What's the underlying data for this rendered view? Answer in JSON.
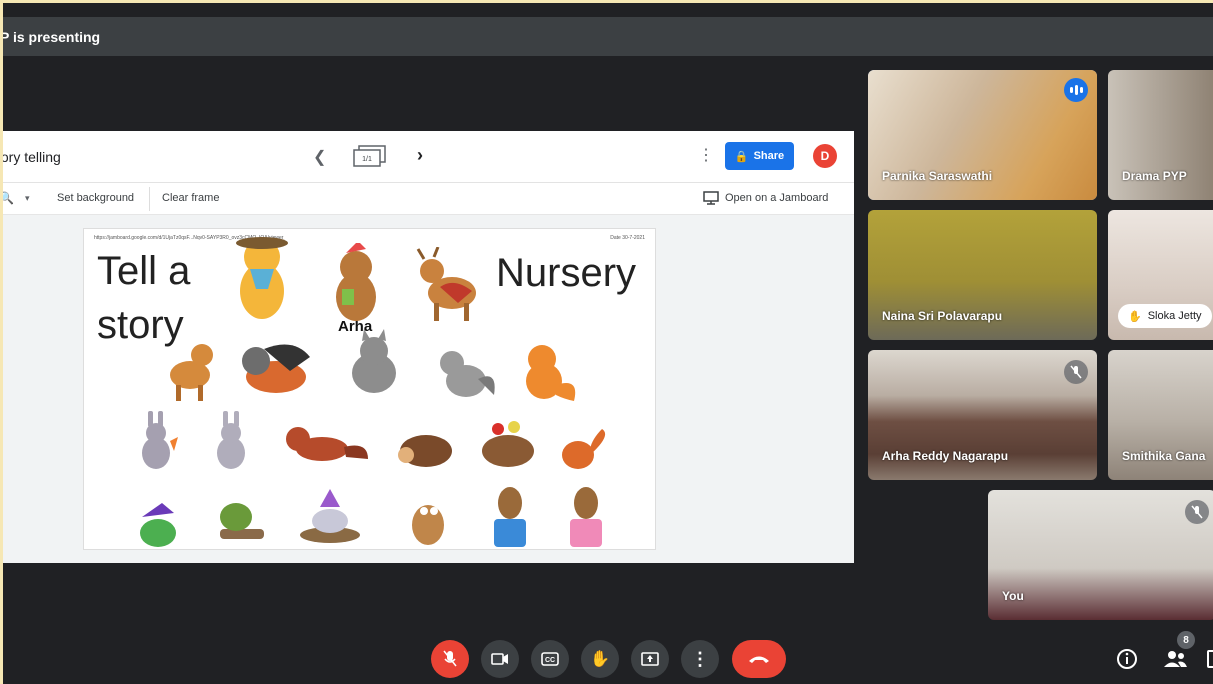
{
  "topbar": {
    "presenter_text": "P is presenting"
  },
  "jamboard": {
    "title": "tory telling",
    "frame_counter": "1/1",
    "share_label": "Share",
    "avatar_letter": "D",
    "toolbar": {
      "set_background": "Set background",
      "clear_frame": "Clear frame",
      "open_on_jamboard": "Open on a Jamboard"
    },
    "canvas": {
      "url": "https://jamboard.google.com/d/1UjaTz0qsF...Nqv0-SAYP3R0_ovz3cCMO_IQA/viewer",
      "date": "Date 30-7-2021",
      "text_tell_a": "Tell a",
      "text_story": "story",
      "text_nursery": "Nursery",
      "sticker_label": "Arha"
    }
  },
  "participants": [
    {
      "name": "Parnika Saraswathi",
      "speaking": true
    },
    {
      "name": "Drama PYP"
    },
    {
      "name": "Naina Sri Polavarapu"
    },
    {
      "name": "Sloka Jetty",
      "hand_raised": true
    },
    {
      "name": "Arha Reddy Nagarapu",
      "muted": true
    },
    {
      "name": "Smithika Gana"
    },
    {
      "name": "You",
      "muted": true
    }
  ],
  "people_count": "8",
  "colors": {
    "accent": "#1a73e8",
    "danger": "#ea4335",
    "bg": "#202124"
  },
  "controls": [
    "mic-off-icon",
    "camera-icon",
    "captions-icon",
    "raise-hand-icon",
    "present-icon",
    "more-icon",
    "end-call-icon"
  ]
}
